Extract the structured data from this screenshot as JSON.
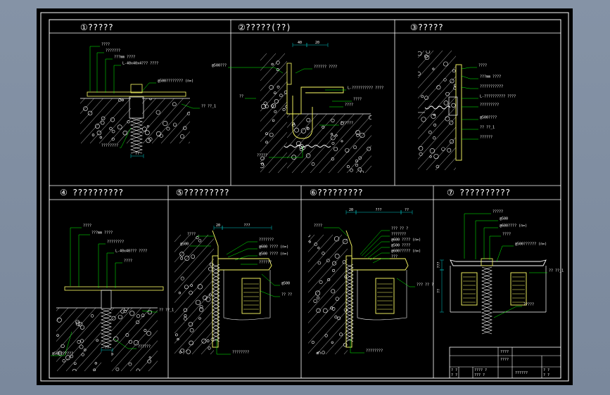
{
  "drawing": {
    "panels": [
      {
        "title": "①?????"
      },
      {
        "title": "②?????(??)"
      },
      {
        "title": "③?????"
      },
      {
        "title": "④ ??????????"
      },
      {
        "title": "⑤?????????"
      },
      {
        "title": "⑥?????????"
      },
      {
        "title": "⑦ ??????????"
      }
    ],
    "colors": {
      "background": "#000000",
      "frame": "#ffffff",
      "leader": "#00ff00",
      "dimension": "#00c8c8",
      "concrete": "#ffffff",
      "metal": "#ffff66",
      "sealant": "#ffffff"
    },
    "p1": {
      "labels": [
        "????",
        "???????",
        "???mm ????",
        "L-40x40x4??? ????",
        "@500???????? (n=)",
        "?? ??_1",
        "????????"
      ],
      "dim_bottom": "??"
    },
    "p2": {
      "labels": [
        "@500???",
        "??",
        "?????? ????",
        "L-?????????? ????",
        "????",
        "????",
        "??????",
        "?????"
      ],
      "dims_top": [
        "40",
        "20"
      ]
    },
    "p3": {
      "labels": [
        "????",
        "???mm ????",
        "???????????",
        "L-?????????? ????",
        "?????????",
        "@500????",
        "?? ??_1",
        "??????"
      ]
    },
    "p4": {
      "labels": [
        "????",
        "???mm ????",
        "????????",
        "L-40x40??? ????",
        "????",
        "?? ??_1",
        "??????",
        "@500??????"
      ],
      "dim_bottom": "??"
    },
    "p5": {
      "labels": [
        "????",
        "@500",
        "???????",
        "@600 ????  (n=)",
        "@500 ????  (n=)",
        "??????",
        "@500",
        "?? ??",
        "????????"
      ],
      "dims_top": [
        "20",
        "???"
      ]
    },
    "p6": {
      "labels": [
        "????",
        "???  ?? ?",
        "???????",
        "@600 ????  (n=)",
        "@500 ????",
        "@600????? (n=)",
        "???",
        "???  ?? ?",
        "????????"
      ],
      "dims_top": [
        "20",
        "???",
        "??"
      ]
    },
    "p7": {
      "labels": [
        "?????",
        "@500",
        "@600????  (n=)",
        "????",
        "@500?????? (n=)",
        "?? ??_1",
        "?????"
      ],
      "dims_left": [
        "???",
        "??"
      ]
    },
    "title_block": {
      "headers": [
        "????",
        "????"
      ],
      "rows": [
        [
          "? ?",
          "???? ?",
          "? ?"
        ],
        [
          "? ?",
          "??? ?",
          "? ?"
        ]
      ],
      "drawing_name": "??????"
    }
  }
}
